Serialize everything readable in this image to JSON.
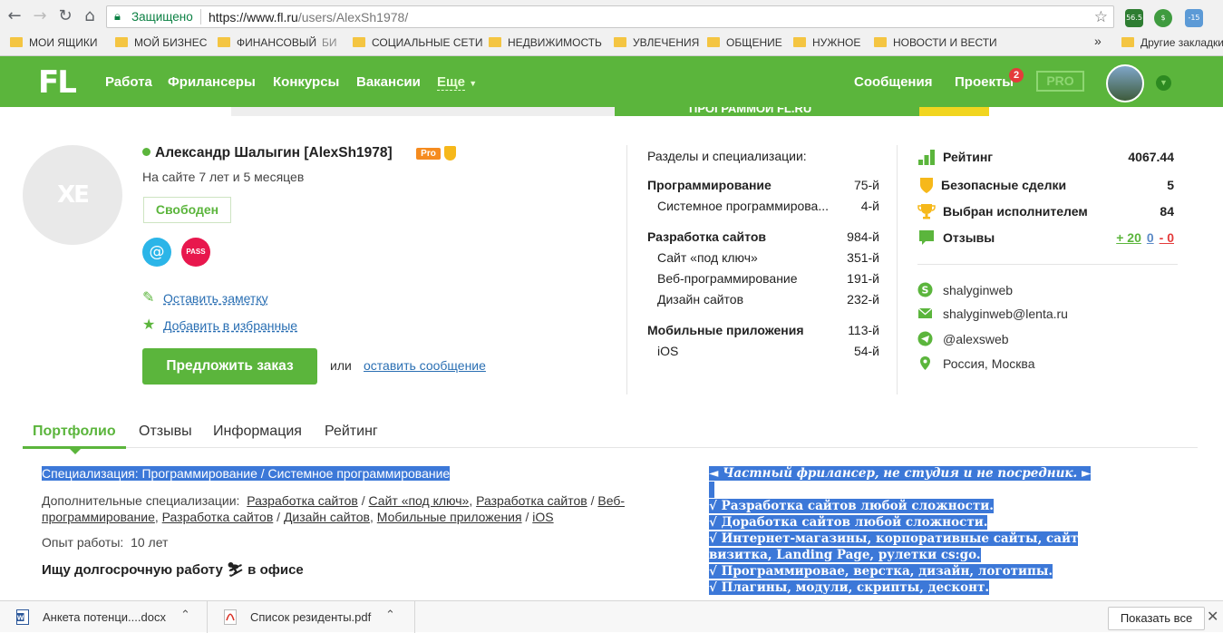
{
  "browser": {
    "secure_label": "Защищено",
    "url_host": "https://www.fl.ru",
    "url_path": "/users/AlexSh1978/",
    "extensions": [
      {
        "name": "ext-1",
        "label": "56.5",
        "color": "#2e7d32"
      },
      {
        "name": "ext-2",
        "label": "$",
        "color": "#3f9b3f"
      },
      {
        "name": "ext-3",
        "label": "-15",
        "color": "#5c9ad6"
      }
    ],
    "bookmarks": [
      "МОИ ЯЩИКИ",
      "МОЙ БИЗНЕС",
      "ФИНАНСОВЫЙ",
      "БИ",
      "СОЦИАЛЬНЫЕ СЕТИ",
      "НЕДВИЖИМОСТЬ",
      "УВЛЕЧЕНИЯ",
      "ОБЩЕНИЕ",
      "НУЖНОЕ",
      "НОВОСТИ  И ВЕСТИ"
    ],
    "bookmarks_more": "»",
    "other_bookmarks": "Другие закладки"
  },
  "site": {
    "logo": "FL",
    "nav": [
      "Работа",
      "Фрилансеры",
      "Конкурсы",
      "Вакансии"
    ],
    "nav_more": "Еще",
    "messages": "Сообщения",
    "projects": "Проекты",
    "projects_count": "2",
    "pro": "PRO",
    "banner_text": "ПРОГРАММОЙ FL.RU"
  },
  "profile": {
    "avatar_text": "XE",
    "name": "Александр Шалыгин [AlexSh1978]",
    "pro_tag": "Pro",
    "onsite": "На сайте 7 лет и 5 месяцев",
    "status": "Свободен",
    "email_badge": "@",
    "pass_badge": "PASS",
    "note_link": "Оставить заметку",
    "fav_link": "Добавить в избранные",
    "order_button": "Предложить заказ",
    "or": "или",
    "message_link": "оставить сообщение"
  },
  "specializations": {
    "title": "Разделы и специализации:",
    "groups": [
      {
        "name": "Программирование",
        "rank": "75-й",
        "items": [
          {
            "name": "Системное программирова...",
            "rank": "4-й"
          }
        ]
      },
      {
        "name": "Разработка сайтов",
        "rank": "984-й",
        "items": [
          {
            "name": "Сайт «под ключ»",
            "rank": "351-й"
          },
          {
            "name": "Веб-программирование",
            "rank": "191-й"
          },
          {
            "name": "Дизайн сайтов",
            "rank": "232-й"
          }
        ]
      },
      {
        "name": "Мобильные приложения",
        "rank": "113-й",
        "items": [
          {
            "name": "iOS",
            "rank": "54-й"
          }
        ]
      }
    ]
  },
  "stats": {
    "rating_label": "Рейтинг",
    "rating_value": "4067.44",
    "safe_deals_label": "Безопасные сделки",
    "safe_deals_value": "5",
    "chosen_label": "Выбран исполнителем",
    "chosen_value": "84",
    "reviews_label": "Отзывы",
    "reviews_pos": "+ 20",
    "reviews_neu": "0",
    "reviews_neg": "- 0"
  },
  "contacts": {
    "skype": "shalyginweb",
    "email": "shalyginweb@lenta.ru",
    "telegram": "@alexsweb",
    "location": "Россия, Москва"
  },
  "tabs": [
    "Портфолио",
    "Отзывы",
    "Информация",
    "Рейтинг"
  ],
  "portfolio": {
    "specialization": "Специализация:   Программирование / Системное программирование",
    "additional_label": "Дополнительные специализации:",
    "additional": [
      "Разработка сайтов",
      "Сайт «под ключ»",
      "Разработка сайтов",
      "Веб-программирование",
      "Разработка сайтов",
      "Дизайн сайтов",
      "Мобильные приложения",
      "iOS"
    ],
    "experience_label": "Опыт работы:",
    "experience_value": "10 лет",
    "looking": "Ищу долгосрочную работу ⛷ в офисе",
    "about": [
      "◄ Частный фрилансер, не студия и не посредник. ►",
      "",
      "√ Разработка сайтов любой сложности.",
      "√ Доработка сайтов любой сложности.",
      "√ Интернет-магазины, корпоративные сайты, сайт визитка, Landing Page, рулетки cs:go.",
      "√ Программироваe, верстка, дизайн, логотипы.",
      "√ Плагины, модули, скрипты, десконт."
    ]
  },
  "downloads": {
    "items": [
      {
        "name": "Анкета потенци....docx",
        "type": "docx"
      },
      {
        "name": "Список резиденты.pdf",
        "type": "pdf"
      }
    ],
    "show_all": "Показать все"
  }
}
